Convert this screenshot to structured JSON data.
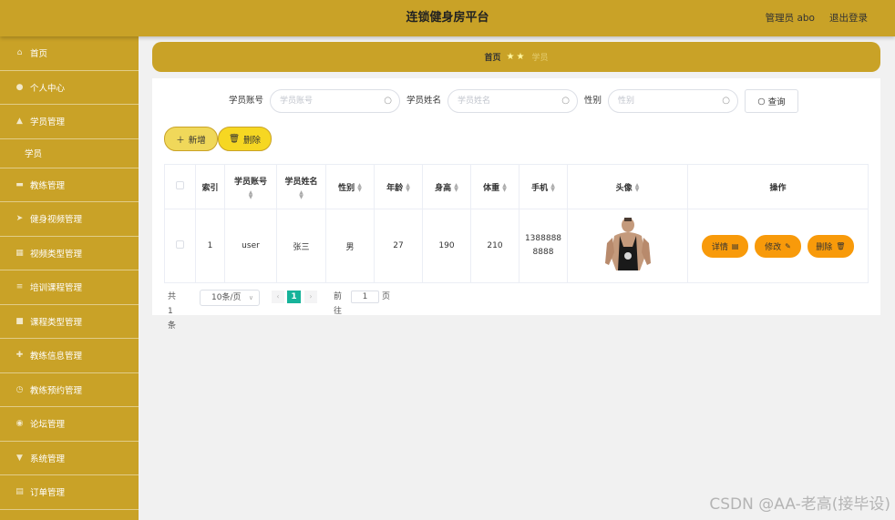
{
  "header": {
    "title": "连锁健身房平台",
    "user_label": "管理员 abo",
    "logout_label": "退出登录"
  },
  "sidebar": {
    "items": [
      {
        "label": "首页",
        "icon": "home-icon"
      },
      {
        "label": "个人中心",
        "icon": "user-icon"
      },
      {
        "label": "学员管理",
        "icon": "group-icon"
      },
      {
        "label": "学员",
        "icon": ""
      },
      {
        "label": "教练管理",
        "icon": "card-icon"
      },
      {
        "label": "健身视频管理",
        "icon": "send-icon"
      },
      {
        "label": "视频类型管理",
        "icon": "grid-icon"
      },
      {
        "label": "培训课程管理",
        "icon": "list-icon"
      },
      {
        "label": "课程类型管理",
        "icon": "doc-icon"
      },
      {
        "label": "教练信息管理",
        "icon": "plus-icon"
      },
      {
        "label": "教练预约管理",
        "icon": "clock-icon"
      },
      {
        "label": "论坛管理",
        "icon": "chat-icon"
      },
      {
        "label": "系统管理",
        "icon": "filter-icon"
      },
      {
        "label": "订单管理",
        "icon": "order-icon"
      }
    ]
  },
  "breadcrumb": {
    "home": "首页",
    "current": "学员"
  },
  "search": {
    "account_label": "学员账号",
    "account_placeholder": "学员账号",
    "name_label": "学员姓名",
    "name_placeholder": "学员姓名",
    "gender_label": "性别",
    "gender_placeholder": "性别",
    "query_label": "查询"
  },
  "actions": {
    "add_label": "新增",
    "delete_label": "删除"
  },
  "table": {
    "columns": [
      "索引",
      "学员账号",
      "学员姓名",
      "性别",
      "年龄",
      "身高",
      "体重",
      "手机",
      "头像",
      "操作"
    ],
    "rows": [
      {
        "index": "1",
        "account": "user",
        "name": "张三",
        "gender": "男",
        "age": "27",
        "height": "190",
        "weight": "210",
        "phone_line1": "1388888",
        "phone_line2": "8888",
        "detail_label": "详情",
        "edit_label": "修改",
        "delete_label": "删除"
      }
    ]
  },
  "pagination": {
    "total_text": "共 1 条",
    "page_size": "10条/页",
    "current_page": "1",
    "goto_label": "前往",
    "goto_value": "1",
    "page_suffix": "页"
  },
  "watermark": "CSDN @AA-老高(接毕设)",
  "colors": {
    "brand": "#c9a227",
    "row_button": "#f89a0a",
    "active_page": "#16b39a"
  }
}
